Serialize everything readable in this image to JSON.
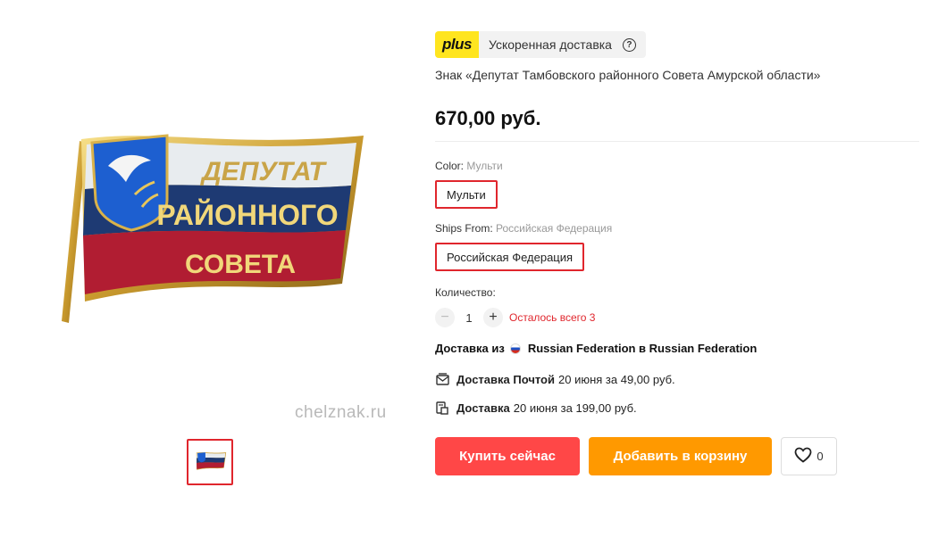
{
  "gallery": {
    "main_image_alt": "Знак «Депутат Тамбовского районного Совета Амурской области»",
    "badge_lines": [
      "ДЕПУТАТ",
      "РАЙОННОГО",
      "СОВЕТА"
    ],
    "watermark": "chelznak.ru"
  },
  "delivery_badge": {
    "logo": "plus",
    "text": "Ускоренная доставка",
    "icon": "help-icon"
  },
  "product": {
    "title": "Знак «Депутат Тамбовского районного Совета Амурской области»",
    "price": "670,00 руб."
  },
  "color": {
    "label": "Color:",
    "value": "Мульти",
    "option": "Мульти"
  },
  "ships_from": {
    "label": "Ships From:",
    "value": "Российская Федерация",
    "option": "Российская Федерация"
  },
  "quantity": {
    "label": "Количество:",
    "value": "1",
    "minus": "−",
    "plus": "+",
    "stock": "Осталось всего 3"
  },
  "shipping": {
    "from_prefix": "Доставка из",
    "route": "Russian Federation в Russian Federation",
    "options": [
      {
        "icon": "mail-icon",
        "name": "Доставка Почтой",
        "detail": "20 июня за 49,00 руб."
      },
      {
        "icon": "parcel-icon",
        "name": "Доставка",
        "detail": "20 июня за 199,00 руб."
      }
    ]
  },
  "actions": {
    "buy_now": "Купить сейчас",
    "add_to_cart": "Добавить в корзину",
    "wishlist_count": "0"
  },
  "colors": {
    "accent_red": "#ff4747",
    "accent_orange": "#ff9900",
    "plus_yellow": "#ffe51f",
    "selected_border": "#e0262d"
  }
}
